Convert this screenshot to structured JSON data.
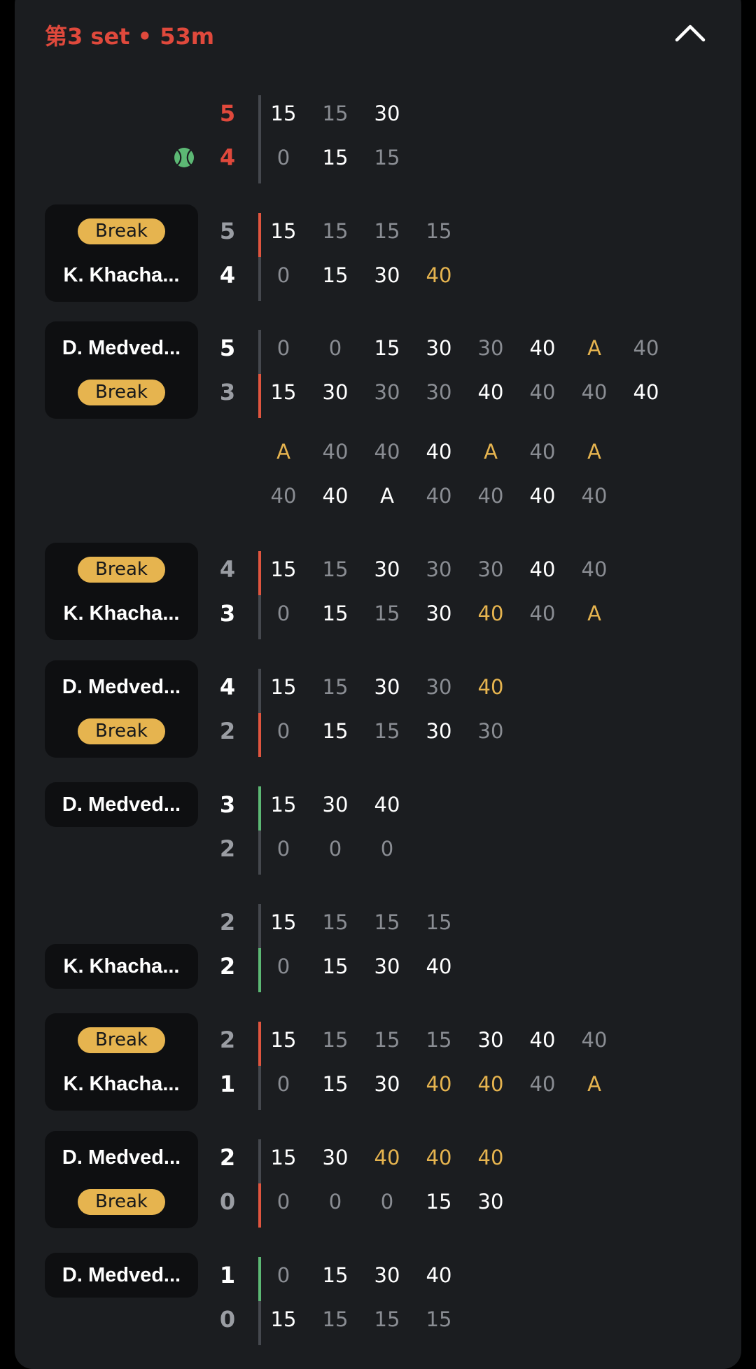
{
  "header": {
    "title": "第3 set • 53m"
  },
  "colors": {
    "card_bg": "#1b1d20",
    "accent_red": "#e0493c",
    "break_yellow": "#e6b44f",
    "hold_green": "#5cb874",
    "point_bright": "#ffffff",
    "point_dim": "#8a8d93"
  },
  "icons": {
    "collapse": "chevron-up-icon",
    "serve": "tennis-ball-icon"
  },
  "games": [
    {
      "badge": null,
      "serve_icon_row": 1,
      "set_color": "red",
      "rows": [
        {
          "score": "5",
          "bar": "gray",
          "points": [
            [
              "15",
              "w"
            ],
            [
              "15",
              "g"
            ],
            [
              "30",
              "w"
            ]
          ]
        },
        {
          "score": "4",
          "bar": "gray",
          "points": [
            [
              "0",
              "g"
            ],
            [
              "15",
              "w"
            ],
            [
              "15",
              "g"
            ]
          ]
        }
      ]
    },
    {
      "badge": {
        "top": "Break",
        "bottom": "K. Khacha..."
      },
      "set_color": "mixed",
      "rows": [
        {
          "score": "5",
          "score_color": "gr",
          "bar": "red",
          "points": [
            [
              "15",
              "w"
            ],
            [
              "15",
              "g"
            ],
            [
              "15",
              "g"
            ],
            [
              "15",
              "g"
            ]
          ]
        },
        {
          "score": "4",
          "score_color": "w",
          "bar": "gray",
          "points": [
            [
              "0",
              "g"
            ],
            [
              "15",
              "w"
            ],
            [
              "30",
              "w"
            ],
            [
              "40",
              "y"
            ]
          ]
        }
      ]
    },
    {
      "badge": {
        "top": "D. Medved...",
        "bottom": "Break"
      },
      "rows": [
        {
          "score": "5",
          "score_color": "w",
          "bar": "gray",
          "points": [
            [
              "0",
              "g"
            ],
            [
              "0",
              "g"
            ],
            [
              "15",
              "w"
            ],
            [
              "30",
              "w"
            ],
            [
              "30",
              "g"
            ],
            [
              "40",
              "w"
            ],
            [
              "A",
              "y"
            ],
            [
              "40",
              "g"
            ]
          ]
        },
        {
          "score": "3",
          "score_color": "gr",
          "bar": "red",
          "points": [
            [
              "15",
              "w"
            ],
            [
              "30",
              "w"
            ],
            [
              "30",
              "g"
            ],
            [
              "30",
              "g"
            ],
            [
              "40",
              "w"
            ],
            [
              "40",
              "g"
            ],
            [
              "40",
              "g"
            ],
            [
              "40",
              "w"
            ]
          ]
        },
        {
          "score": "",
          "bar": "none",
          "points": [
            [
              "A",
              "y"
            ],
            [
              "40",
              "g"
            ],
            [
              "40",
              "g"
            ],
            [
              "40",
              "w"
            ],
            [
              "A",
              "y"
            ],
            [
              "40",
              "g"
            ],
            [
              "A",
              "y"
            ]
          ]
        },
        {
          "score": "",
          "bar": "none",
          "points": [
            [
              "40",
              "g"
            ],
            [
              "40",
              "w"
            ],
            [
              "A",
              "w"
            ],
            [
              "40",
              "g"
            ],
            [
              "40",
              "g"
            ],
            [
              "40",
              "w"
            ],
            [
              "40",
              "g"
            ]
          ]
        }
      ]
    },
    {
      "badge": {
        "top": "Break",
        "bottom": "K. Khacha..."
      },
      "rows": [
        {
          "score": "4",
          "score_color": "gr",
          "bar": "red",
          "points": [
            [
              "15",
              "w"
            ],
            [
              "15",
              "g"
            ],
            [
              "30",
              "w"
            ],
            [
              "30",
              "g"
            ],
            [
              "30",
              "g"
            ],
            [
              "40",
              "w"
            ],
            [
              "40",
              "g"
            ]
          ]
        },
        {
          "score": "3",
          "score_color": "w",
          "bar": "gray",
          "points": [
            [
              "0",
              "g"
            ],
            [
              "15",
              "w"
            ],
            [
              "15",
              "g"
            ],
            [
              "30",
              "w"
            ],
            [
              "40",
              "y"
            ],
            [
              "40",
              "g"
            ],
            [
              "A",
              "y"
            ]
          ]
        }
      ]
    },
    {
      "badge": {
        "top": "D. Medved...",
        "bottom": "Break"
      },
      "rows": [
        {
          "score": "4",
          "score_color": "w",
          "bar": "gray",
          "points": [
            [
              "15",
              "w"
            ],
            [
              "15",
              "g"
            ],
            [
              "30",
              "w"
            ],
            [
              "30",
              "g"
            ],
            [
              "40",
              "y"
            ]
          ]
        },
        {
          "score": "2",
          "score_color": "gr",
          "bar": "red",
          "points": [
            [
              "0",
              "g"
            ],
            [
              "15",
              "w"
            ],
            [
              "15",
              "g"
            ],
            [
              "30",
              "w"
            ],
            [
              "30",
              "g"
            ]
          ]
        }
      ]
    },
    {
      "badge": {
        "top": "D. Medved...",
        "bottom": null
      },
      "rows": [
        {
          "score": "3",
          "score_color": "w",
          "bar": "green",
          "points": [
            [
              "15",
              "w"
            ],
            [
              "30",
              "w"
            ],
            [
              "40",
              "w"
            ]
          ]
        },
        {
          "score": "2",
          "score_color": "gr",
          "bar": "gray",
          "points": [
            [
              "0",
              "g"
            ],
            [
              "0",
              "g"
            ],
            [
              "0",
              "g"
            ]
          ]
        }
      ]
    },
    {
      "badge": {
        "top": null,
        "bottom": "K. Khacha..."
      },
      "rows": [
        {
          "score": "2",
          "score_color": "gr",
          "bar": "gray",
          "points": [
            [
              "15",
              "w"
            ],
            [
              "15",
              "g"
            ],
            [
              "15",
              "g"
            ],
            [
              "15",
              "g"
            ]
          ]
        },
        {
          "score": "2",
          "score_color": "w",
          "bar": "green",
          "points": [
            [
              "0",
              "g"
            ],
            [
              "15",
              "w"
            ],
            [
              "30",
              "w"
            ],
            [
              "40",
              "w"
            ]
          ]
        }
      ]
    },
    {
      "badge": {
        "top": "Break",
        "bottom": "K. Khacha..."
      },
      "rows": [
        {
          "score": "2",
          "score_color": "gr",
          "bar": "red",
          "points": [
            [
              "15",
              "w"
            ],
            [
              "15",
              "g"
            ],
            [
              "15",
              "g"
            ],
            [
              "15",
              "g"
            ],
            [
              "30",
              "w"
            ],
            [
              "40",
              "w"
            ],
            [
              "40",
              "g"
            ]
          ]
        },
        {
          "score": "1",
          "score_color": "w",
          "bar": "gray",
          "points": [
            [
              "0",
              "g"
            ],
            [
              "15",
              "w"
            ],
            [
              "30",
              "w"
            ],
            [
              "40",
              "y"
            ],
            [
              "40",
              "y"
            ],
            [
              "40",
              "g"
            ],
            [
              "A",
              "y"
            ]
          ]
        }
      ]
    },
    {
      "badge": {
        "top": "D. Medved...",
        "bottom": "Break"
      },
      "rows": [
        {
          "score": "2",
          "score_color": "w",
          "bar": "gray",
          "points": [
            [
              "15",
              "w"
            ],
            [
              "30",
              "w"
            ],
            [
              "40",
              "y"
            ],
            [
              "40",
              "y"
            ],
            [
              "40",
              "y"
            ]
          ]
        },
        {
          "score": "0",
          "score_color": "gr",
          "bar": "red",
          "points": [
            [
              "0",
              "g"
            ],
            [
              "0",
              "g"
            ],
            [
              "0",
              "g"
            ],
            [
              "15",
              "w"
            ],
            [
              "30",
              "w"
            ]
          ]
        }
      ]
    },
    {
      "badge": {
        "top": "D. Medved...",
        "bottom": null
      },
      "rows": [
        {
          "score": "1",
          "score_color": "w",
          "bar": "green",
          "points": [
            [
              "0",
              "g"
            ],
            [
              "15",
              "w"
            ],
            [
              "30",
              "w"
            ],
            [
              "40",
              "w"
            ]
          ]
        },
        {
          "score": "0",
          "score_color": "gr",
          "bar": "gray",
          "points": [
            [
              "15",
              "w"
            ],
            [
              "15",
              "g"
            ],
            [
              "15",
              "g"
            ],
            [
              "15",
              "g"
            ]
          ]
        }
      ]
    }
  ]
}
